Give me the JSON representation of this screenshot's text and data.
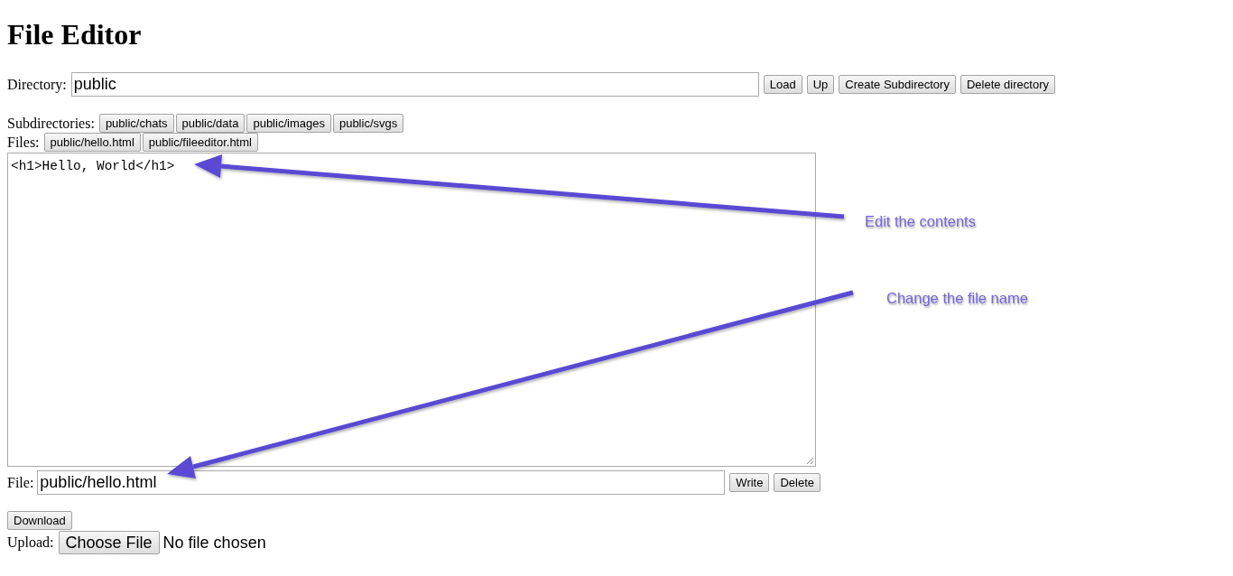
{
  "title": "File Editor",
  "directory": {
    "label": "Directory:",
    "value": "public",
    "buttons": [
      "Load",
      "Up",
      "Create Subdirectory",
      "Delete directory"
    ]
  },
  "subdirectories": {
    "label": "Subdirectories:",
    "items": [
      "public/chats",
      "public/data",
      "public/images",
      "public/svgs"
    ]
  },
  "files": {
    "label": "Files:",
    "items": [
      "public/hello.html",
      "public/fileeditor.html"
    ]
  },
  "editor": {
    "value": "<h1>Hello, World</h1>"
  },
  "file": {
    "label": "File:",
    "value": "public/hello.html",
    "buttons": [
      "Write",
      "Delete"
    ]
  },
  "download_button": "Download",
  "upload": {
    "label": "Upload:",
    "button": "Choose File",
    "status": "No file chosen"
  },
  "annotations": [
    {
      "text": "Edit the contents"
    },
    {
      "text": "Change the file name"
    }
  ]
}
